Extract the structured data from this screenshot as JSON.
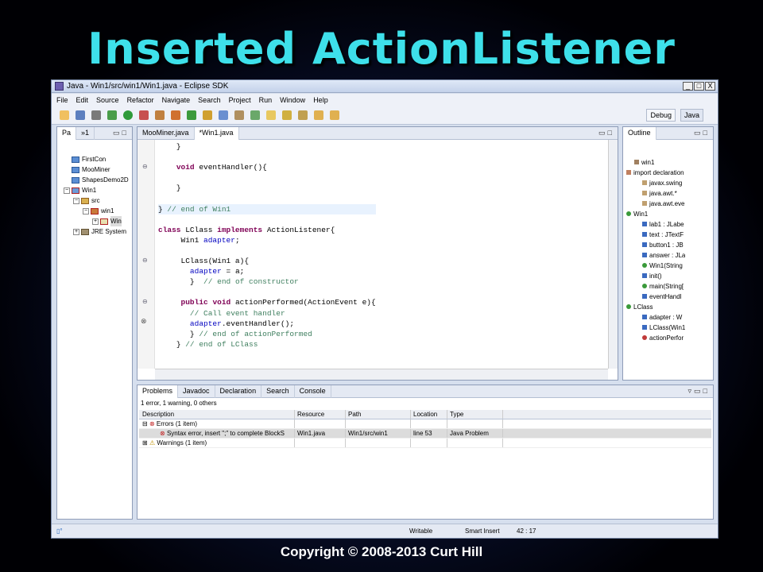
{
  "slide": {
    "title": "Inserted  ActionListener",
    "copyright": "Copyright © 2008-2013 Curt Hill"
  },
  "window": {
    "title": "Java - Win1/src/win1/Win1.java - Eclipse SDK",
    "buttons": [
      "_",
      "□",
      "X"
    ]
  },
  "menu": [
    "File",
    "Edit",
    "Source",
    "Refactor",
    "Navigate",
    "Search",
    "Project",
    "Run",
    "Window",
    "Help"
  ],
  "perspectives": {
    "debug": "Debug",
    "java": "Java"
  },
  "package_explorer": {
    "tab": "Pa",
    "extra": "»1",
    "items": [
      "FirstCon",
      "MooMiner",
      "ShapesDemo2D",
      "Win1",
      "src",
      "win1",
      "Win",
      "JRE System"
    ]
  },
  "editor": {
    "tabs": [
      "MooMiner.java",
      "*Win1.java"
    ],
    "lines": [
      {
        "indent": "    ",
        "parts": [
          {
            "t": "}",
            "c": ""
          }
        ]
      },
      {
        "indent": "",
        "parts": []
      },
      {
        "indent": "    ",
        "parts": [
          {
            "t": "void",
            "c": "kw"
          },
          {
            "t": " eventHandler(){",
            "c": ""
          }
        ]
      },
      {
        "indent": "",
        "parts": []
      },
      {
        "indent": "    ",
        "parts": [
          {
            "t": "}",
            "c": ""
          }
        ]
      },
      {
        "indent": "",
        "parts": []
      },
      {
        "indent": "",
        "parts": [
          {
            "t": "} ",
            "c": ""
          },
          {
            "t": "// end of Win1",
            "c": "cm"
          }
        ]
      },
      {
        "indent": "",
        "parts": []
      },
      {
        "indent": "",
        "parts": [
          {
            "t": "class",
            "c": "kw"
          },
          {
            "t": " LClass ",
            "c": ""
          },
          {
            "t": "implements",
            "c": "kw"
          },
          {
            "t": " ActionListener{",
            "c": ""
          }
        ]
      },
      {
        "indent": "     ",
        "parts": [
          {
            "t": "Win1 ",
            "c": ""
          },
          {
            "t": "adapter",
            "c": "fld"
          },
          {
            "t": ";",
            "c": ""
          }
        ]
      },
      {
        "indent": "",
        "parts": []
      },
      {
        "indent": "     ",
        "parts": [
          {
            "t": "LClass(Win1 a){",
            "c": ""
          }
        ]
      },
      {
        "indent": "       ",
        "parts": [
          {
            "t": "adapter",
            "c": "fld"
          },
          {
            "t": " = a;",
            "c": ""
          }
        ]
      },
      {
        "indent": "       ",
        "parts": [
          {
            "t": "}  ",
            "c": ""
          },
          {
            "t": "// end of constructor",
            "c": "cm"
          }
        ]
      },
      {
        "indent": "",
        "parts": []
      },
      {
        "indent": "     ",
        "parts": [
          {
            "t": "public",
            "c": "kw"
          },
          {
            "t": " ",
            "c": ""
          },
          {
            "t": "void",
            "c": "kw"
          },
          {
            "t": " actionPerformed(ActionEvent e){",
            "c": ""
          }
        ]
      },
      {
        "indent": "       ",
        "parts": [
          {
            "t": "// Call event handler",
            "c": "cm"
          }
        ]
      },
      {
        "indent": "       ",
        "parts": [
          {
            "t": "adapter",
            "c": "fld"
          },
          {
            "t": ".eventHandler();",
            "c": ""
          }
        ]
      },
      {
        "indent": "       ",
        "parts": [
          {
            "t": "} ",
            "c": ""
          },
          {
            "t": "// end of actionPerformed",
            "c": "cm"
          }
        ]
      },
      {
        "indent": "    ",
        "parts": [
          {
            "t": "} ",
            "c": ""
          },
          {
            "t": "// end of LClass",
            "c": "cm"
          }
        ]
      }
    ]
  },
  "outline": {
    "tab": "Outline",
    "items": [
      "win1",
      "import declaration",
      "javax.swing",
      "java.awt.*",
      "java.awt.eve",
      "Win1",
      "lab1 : JLabe",
      "text : JTextF",
      "button1 : JB",
      "answer : JLa",
      "Win1(String",
      "init()",
      "main(String[",
      "eventHandl",
      "LClass",
      "adapter : W",
      "LClass(Win1",
      "actionPerfor"
    ]
  },
  "problems": {
    "tabs": [
      "Problems",
      "Javadoc",
      "Declaration",
      "Search",
      "Console"
    ],
    "summary": "1 error, 1 warning, 0 others",
    "columns": [
      "Description",
      "Resource",
      "Path",
      "Location",
      "Type"
    ],
    "rows": [
      {
        "description": "Errors (1 item)",
        "resource": "",
        "path": "",
        "location": "",
        "type": ""
      },
      {
        "description": "Syntax error, insert \";\" to complete BlockS",
        "resource": "Win1.java",
        "path": "Win1/src/win1",
        "location": "line 53",
        "type": "Java Problem"
      },
      {
        "description": "Warnings (1 item)",
        "resource": "",
        "path": "",
        "location": "",
        "type": ""
      }
    ]
  },
  "status": {
    "writable": "Writable",
    "insert": "Smart Insert",
    "position": "42 : 17"
  }
}
